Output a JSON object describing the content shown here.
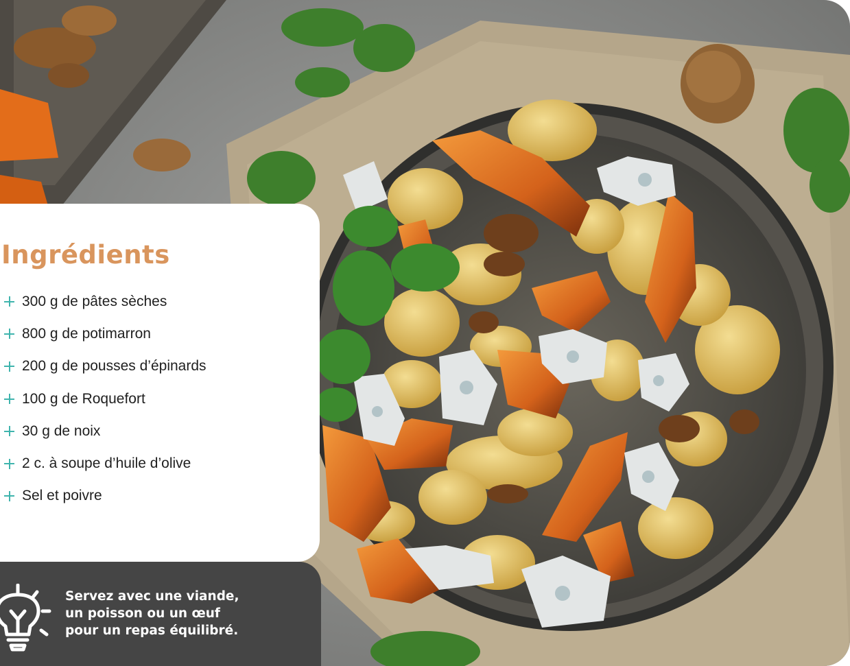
{
  "ingredients": {
    "title": "Ingrédients",
    "items": [
      "300 g de pâtes sèches",
      "800 g de potimarron",
      "200 g de pousses d’épinards",
      "100 g de Roquefort",
      "30 g de noix",
      "2 c. à soupe d’huile d’olive",
      "Sel et poivre"
    ]
  },
  "tip": {
    "lines": [
      "Servez avec une viande,",
      "un poisson ou un œuf",
      "pour un repas équilibré."
    ]
  },
  "colors": {
    "title": "#d9955d",
    "bullet": "#3fb4ad",
    "tip_background": "#454545",
    "text": "#1f1f1f"
  },
  "icons": {
    "bullet": "plus-icon",
    "tip": "lightbulb-icon"
  }
}
